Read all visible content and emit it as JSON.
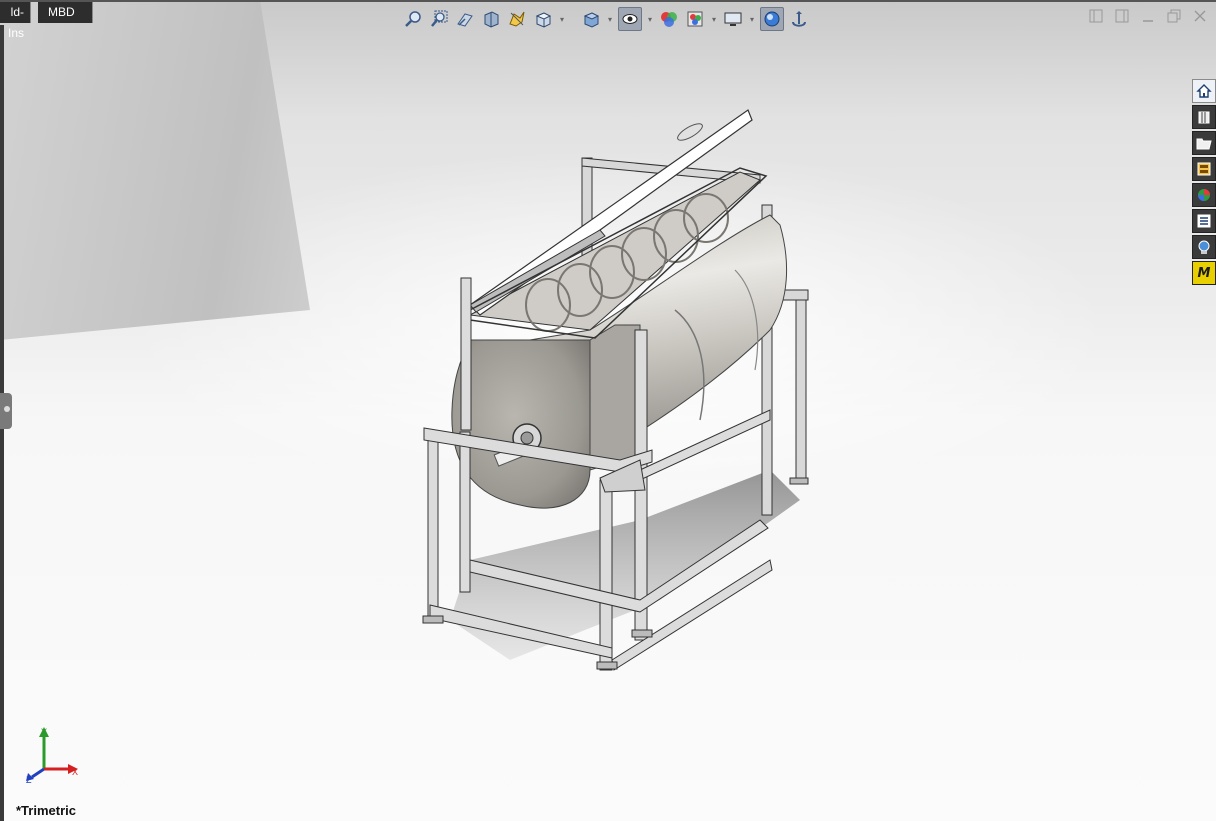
{
  "tabs": [
    {
      "label": "ld-Ins"
    },
    {
      "label": "MBD"
    }
  ],
  "hud_toolbar": {
    "icons": [
      "zoom-to-fit-icon",
      "zoom-to-area-icon",
      "previous-view-icon",
      "section-view-icon",
      "dynamic-annotation-icon",
      "view-orientation-icon",
      "display-style-icon",
      "hide-show-items-icon",
      "edit-appearance-icon",
      "apply-scene-icon",
      "view-settings-icon",
      "realview-icon",
      "camera-icon"
    ]
  },
  "taskpane": {
    "icons": [
      "solidworks-resources-icon",
      "design-library-icon",
      "file-explorer-icon",
      "view-palette-icon",
      "appearances-icon",
      "custom-properties-icon",
      "solidworks-forum-icon",
      "mbd-icon"
    ],
    "mbd_letter": "M"
  },
  "triad": {
    "x_label": "X",
    "y_label": "Y",
    "z_label": "Z"
  },
  "view": {
    "orientation_label": "*Trimetric"
  },
  "colors": {
    "tab_bg": "#2d2d2d",
    "tab_text": "#ffffff",
    "axis_x": "#d42020",
    "axis_y": "#2a9a2a",
    "axis_z": "#2040c0",
    "mbd_icon_bg": "#e8d000"
  }
}
